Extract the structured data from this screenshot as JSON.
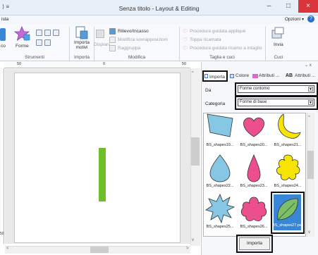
{
  "window": {
    "title": "Senza titolo - Layout & Editing",
    "minimize": "–",
    "maximize": "□",
    "close": "×"
  },
  "menubar": {
    "left": "ista",
    "options": "Opzioni",
    "options_arrow": "▾",
    "help": "?"
  },
  "ribbon": {
    "groups": {
      "strumenti": "Strumenti",
      "importa": "Importa",
      "modifica": "Modifica",
      "taglia": "Taglia e cuci",
      "cuci": "Cuci"
    },
    "buttons": {
      "co": "co",
      "forme": "Forme",
      "importa_motivi": "Importa motivi",
      "dispiani": "Dispiani",
      "rilievo": "Rilievo/Incasso",
      "modifica_sovrapp": "Modifica sovrapposizioni",
      "raggruppa": "Raggruppa",
      "procedura_applique": "Procedura guidata appliqué",
      "toppa_ricamata": "Toppa ricamata",
      "procedura_taglio": "Procedura guidata ricamo a intaglio",
      "invia": "Invia"
    }
  },
  "rulers": {
    "marks": [
      "50",
      "0",
      "50"
    ],
    "panel_mark": "50",
    "left_mark": "50"
  },
  "panel": {
    "pin": "⌄ x",
    "tabs": [
      "Importa",
      "Colore",
      "Attributi ...",
      "Attributi ..."
    ],
    "da_label": "Da",
    "da_value": "Forme contorno",
    "categoria_label": "Categoria",
    "categoria_value": "Forme di base",
    "shapes": [
      "BS_shapes19...",
      "BS_shapes20...",
      "BS_shapes21...",
      "BS_shapes22...",
      "BS_shapes23...",
      "BS_shapes24...",
      "BS_shapes25...",
      "BS_shapes26...",
      "BS_shapes27.pes"
    ],
    "import_button": "Importa"
  },
  "colors": {
    "accent_green": "#6fbf2a",
    "close_red": "#d9353a",
    "shape_blue": "#86c7e3",
    "shape_pink": "#ec4f8e",
    "shape_yellow": "#f7e400",
    "shape_leaf": "#7cbf6a"
  }
}
